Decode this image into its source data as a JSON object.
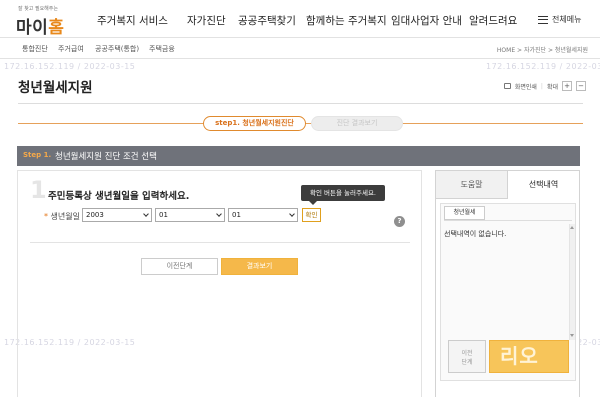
{
  "header": {
    "logo_tagline": "잘 찾고 필요해주는",
    "logo_main_1": "마이",
    "logo_main_2": "홈",
    "nav": [
      "주거복지 서비스",
      "자가진단",
      "공공주택찾기",
      "함께하는 주거복지",
      "임대사업자 안내",
      "알려드려요"
    ],
    "menu_label": "전체메뉴"
  },
  "subnav": {
    "items": [
      "통합진단",
      "주거급여",
      "공공주택(통합)",
      "주택금융"
    ],
    "breadcrumb": "HOME > 자가진단 > 청년월세지원"
  },
  "watermark": {
    "text": "172.16.152.119 / 2022-03-15",
    "text_right": "172.16.152.119 / 2022-03-15"
  },
  "page": {
    "title": "청년월세지원",
    "print_label": "화면인쇄",
    "zoom_label": "확대",
    "zoom_in": "+",
    "zoom_out": "−"
  },
  "steps": {
    "step1": "step1. 청년월세지원진단",
    "step2": "진단 결과보기"
  },
  "step_bar": {
    "num": "Step 1.",
    "text": "청년월세지원 진단 조건 선택"
  },
  "form": {
    "index": "1",
    "question": "주민등록상 생년월일을 입력하세요.",
    "required_mark": "*",
    "field_label": "생년월일",
    "year": "2003",
    "month": "01",
    "day": "01",
    "confirm": "확인",
    "tooltip": "확인 버튼을 눌러주세요.",
    "help": "?",
    "prev": "이전단계",
    "result": "결과보기"
  },
  "side": {
    "tab_help": "도움말",
    "tab_selected": "선택내역",
    "mini_tab": "청년월세",
    "empty_text": "선택내역이 없습니다.",
    "prev_button": "이전\n단계",
    "next_button_overlay": "리오"
  }
}
